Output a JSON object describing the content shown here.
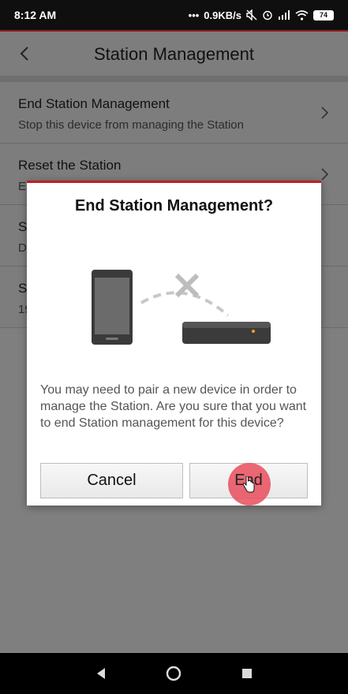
{
  "status_bar": {
    "time": "8:12 AM",
    "network_speed": "0.9KB/s",
    "battery": "74",
    "icons": [
      "dots-icon",
      "mute-icon",
      "alarm-icon",
      "signal-icon",
      "wifi-icon",
      "battery-icon"
    ]
  },
  "header": {
    "title": "Station Management",
    "back_icon": "chevron-left-icon"
  },
  "list": {
    "items": [
      {
        "title": "End Station Management",
        "subtitle": "Stop this device from managing the Station"
      },
      {
        "title": "Reset the Station",
        "subtitle": "Er"
      },
      {
        "title": "S",
        "subtitle": "D"
      },
      {
        "title": "S",
        "subtitle": "19"
      }
    ]
  },
  "dialog": {
    "title": "End Station Management?",
    "message": "You may need to pair a new device in order to manage the Station. Are you sure that you want to end Station management for this device?",
    "cancel_label": "Cancel",
    "end_label": "End",
    "accent_color": "#c21f24"
  },
  "nav_bar": {
    "icons": [
      "back-triangle-icon",
      "home-circle-icon",
      "recents-square-icon"
    ]
  }
}
